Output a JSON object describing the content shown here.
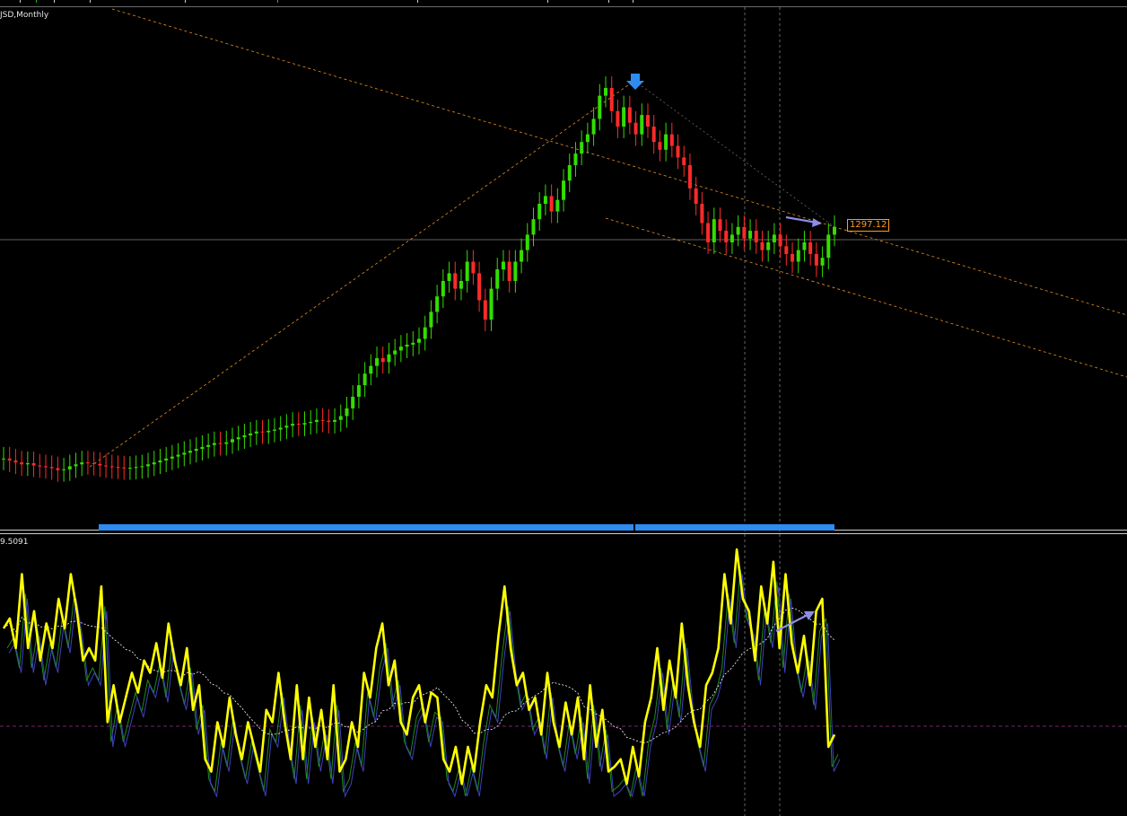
{
  "window": {
    "symbol_label": "JSD,Monthly",
    "sub_label": "9.5091"
  },
  "colors": {
    "background": "#000000",
    "bull_candle": "#33dd00",
    "bear_candle": "#ff2a2a",
    "trendline": "#e8901c",
    "hline": "#bdbdbd",
    "blue_marker": "#2e8cf0",
    "arrow": "#8c8ce6",
    "osc_main": "#ffff00",
    "osc_green": "#1d8a1d",
    "osc_blue": "#4040c0",
    "osc_signal": "#ffffff",
    "osc_level": "#a0308e"
  },
  "chart_data": [
    {
      "type": "candlestick",
      "title": "",
      "price_tag": "1297.12",
      "close_series": [
        0.04,
        0.035,
        0.03,
        0.025,
        0.028,
        0.022,
        0.02,
        0.018,
        0.015,
        0.01,
        0.012,
        0.02,
        0.025,
        0.03,
        0.028,
        0.026,
        0.022,
        0.02,
        0.018,
        0.017,
        0.015,
        0.016,
        0.018,
        0.02,
        0.025,
        0.03,
        0.035,
        0.04,
        0.045,
        0.05,
        0.055,
        0.06,
        0.065,
        0.07,
        0.075,
        0.08,
        0.078,
        0.082,
        0.09,
        0.095,
        0.1,
        0.105,
        0.11,
        0.108,
        0.112,
        0.115,
        0.12,
        0.125,
        0.13,
        0.128,
        0.132,
        0.135,
        0.14,
        0.138,
        0.135,
        0.14,
        0.15,
        0.17,
        0.2,
        0.23,
        0.26,
        0.28,
        0.3,
        0.29,
        0.31,
        0.32,
        0.33,
        0.335,
        0.34,
        0.35,
        0.38,
        0.42,
        0.46,
        0.5,
        0.52,
        0.48,
        0.5,
        0.55,
        0.52,
        0.45,
        0.4,
        0.48,
        0.53,
        0.55,
        0.5,
        0.55,
        0.58,
        0.62,
        0.66,
        0.7,
        0.72,
        0.68,
        0.71,
        0.76,
        0.8,
        0.83,
        0.86,
        0.88,
        0.92,
        0.98,
        1.0,
        0.94,
        0.9,
        0.95,
        0.91,
        0.88,
        0.93,
        0.9,
        0.86,
        0.84,
        0.88,
        0.85,
        0.82,
        0.8,
        0.74,
        0.7,
        0.65,
        0.6,
        0.66,
        0.63,
        0.6,
        0.62,
        0.64,
        0.61,
        0.63,
        0.6,
        0.58,
        0.6,
        0.62,
        0.59,
        0.57,
        0.55,
        0.58,
        0.6,
        0.57,
        0.54,
        0.56,
        0.62,
        0.64
      ],
      "ohlc_scale": {
        "close_min": 0.0,
        "close_max": 1.0
      }
    },
    {
      "type": "line",
      "title": "",
      "series": [
        {
          "values": [
            0.68,
            0.72,
            0.6,
            0.9,
            0.6,
            0.75,
            0.55,
            0.7,
            0.6,
            0.8,
            0.68,
            0.9,
            0.75,
            0.55,
            0.6,
            0.55,
            0.85,
            0.3,
            0.45,
            0.3,
            0.4,
            0.5,
            0.42,
            0.55,
            0.5,
            0.62,
            0.48,
            0.7,
            0.55,
            0.45,
            0.6,
            0.35,
            0.45,
            0.15,
            0.1,
            0.3,
            0.2,
            0.4,
            0.25,
            0.15,
            0.3,
            0.2,
            0.1,
            0.35,
            0.3,
            0.5,
            0.3,
            0.15,
            0.45,
            0.15,
            0.4,
            0.2,
            0.35,
            0.15,
            0.45,
            0.1,
            0.15,
            0.3,
            0.2,
            0.5,
            0.4,
            0.6,
            0.7,
            0.45,
            0.55,
            0.3,
            0.25,
            0.4,
            0.45,
            0.3,
            0.42,
            0.4,
            0.15,
            0.1,
            0.2,
            0.05,
            0.2,
            0.1,
            0.3,
            0.45,
            0.4,
            0.65,
            0.85,
            0.6,
            0.45,
            0.5,
            0.35,
            0.4,
            0.25,
            0.5,
            0.3,
            0.2,
            0.38,
            0.25,
            0.4,
            0.15,
            0.45,
            0.2,
            0.35,
            0.1,
            0.12,
            0.15,
            0.05,
            0.2,
            0.08,
            0.3,
            0.4,
            0.6,
            0.35,
            0.55,
            0.4,
            0.7,
            0.45,
            0.3,
            0.2,
            0.45,
            0.5,
            0.6,
            0.9,
            0.7,
            1.0,
            0.8,
            0.75,
            0.55,
            0.85,
            0.7,
            0.95,
            0.6,
            0.9,
            0.62,
            0.5,
            0.65,
            0.45,
            0.75,
            0.8,
            0.2,
            0.25
          ]
        }
      ]
    }
  ]
}
